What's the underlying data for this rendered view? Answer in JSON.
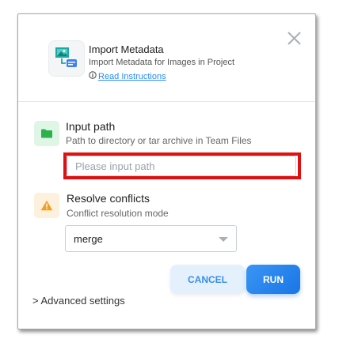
{
  "app": {
    "title": "Import Metadata",
    "description": "Import Metadata for Images in Project",
    "instructions_link": "Read Instructions",
    "icon": "import-metadata-app-icon"
  },
  "input_path": {
    "title": "Input path",
    "description": "Path to directory or tar archive in Team Files",
    "placeholder": "Please input path",
    "value": "",
    "icon": "folder-icon"
  },
  "resolve_conflicts": {
    "title": "Resolve conflicts",
    "description": "Conflict resolution mode",
    "selected": "merge",
    "icon": "warning-icon"
  },
  "buttons": {
    "cancel": "CANCEL",
    "run": "RUN"
  },
  "advanced": {
    "label": "> Advanced settings"
  },
  "colors": {
    "accent": "#1976e6",
    "link": "#2a8bf2",
    "highlight": "#e01010",
    "folder_bg": "#dff5e5",
    "folder": "#2bb24c",
    "warning_bg": "#fdf0dc",
    "warning": "#f0a020"
  }
}
